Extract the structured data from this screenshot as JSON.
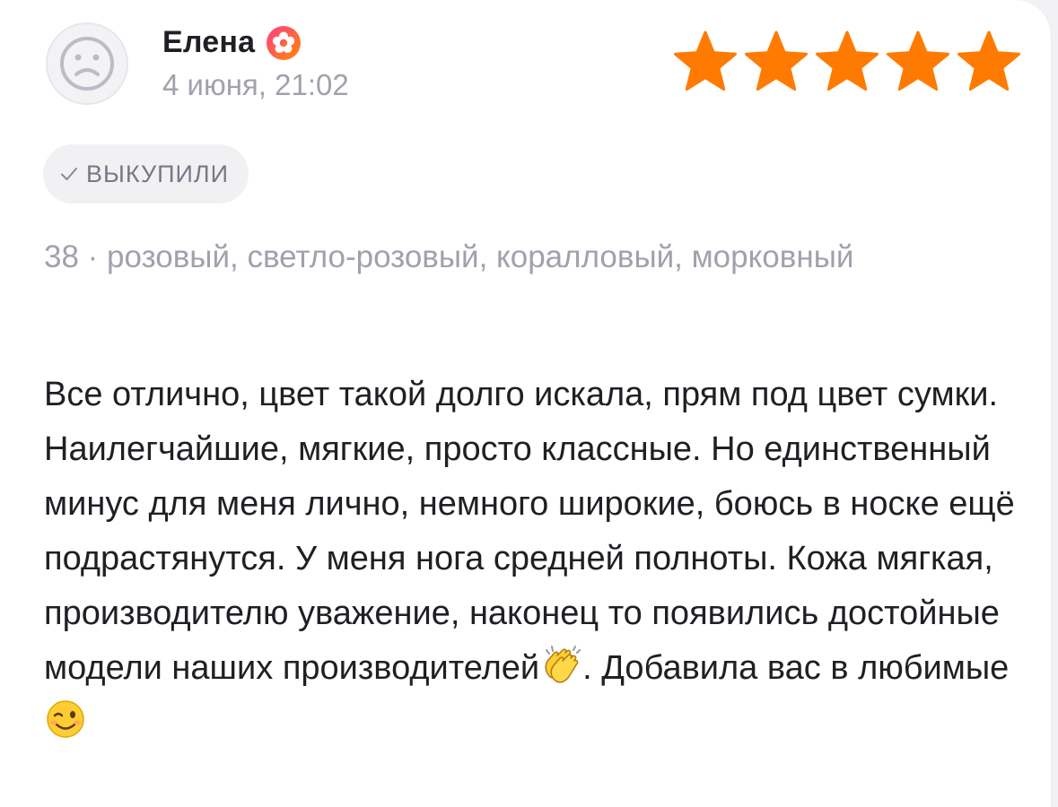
{
  "review": {
    "author": "Елена",
    "date": "4 июня, 21:02",
    "rating": 5,
    "rating_max": 5,
    "status_badge": "ВЫКУПИЛИ",
    "variant_line": "38 · розовый, светло-розовый, коралловый, морковный",
    "text_part1": "Все отлично, цвет такой долго искала, прям под цвет сумки. Наилегчайшие, мягкие, просто классные. Но единственный минус для меня лично, немного широкие, боюсь в носке ещё подрастянутся. У меня нога средней полноты. Кожа мягкая, производителю уважение, наконец то появились достойные модели наших производителей",
    "text_part2": ". Добавила вас в любимые",
    "emojis": [
      "clapping-hands-emoji",
      "winking-face-emoji"
    ]
  },
  "colors": {
    "star": "#ff7a00",
    "badge_gradient_start": "#ff3b8b",
    "badge_gradient_end": "#ff8a00",
    "muted_text": "#a3a0ad",
    "main_text": "#1f1f24"
  },
  "icons": {
    "avatar": "sad-face-avatar-icon",
    "author_badge": "flower-badge-icon",
    "check": "check-icon",
    "star": "star-icon"
  }
}
